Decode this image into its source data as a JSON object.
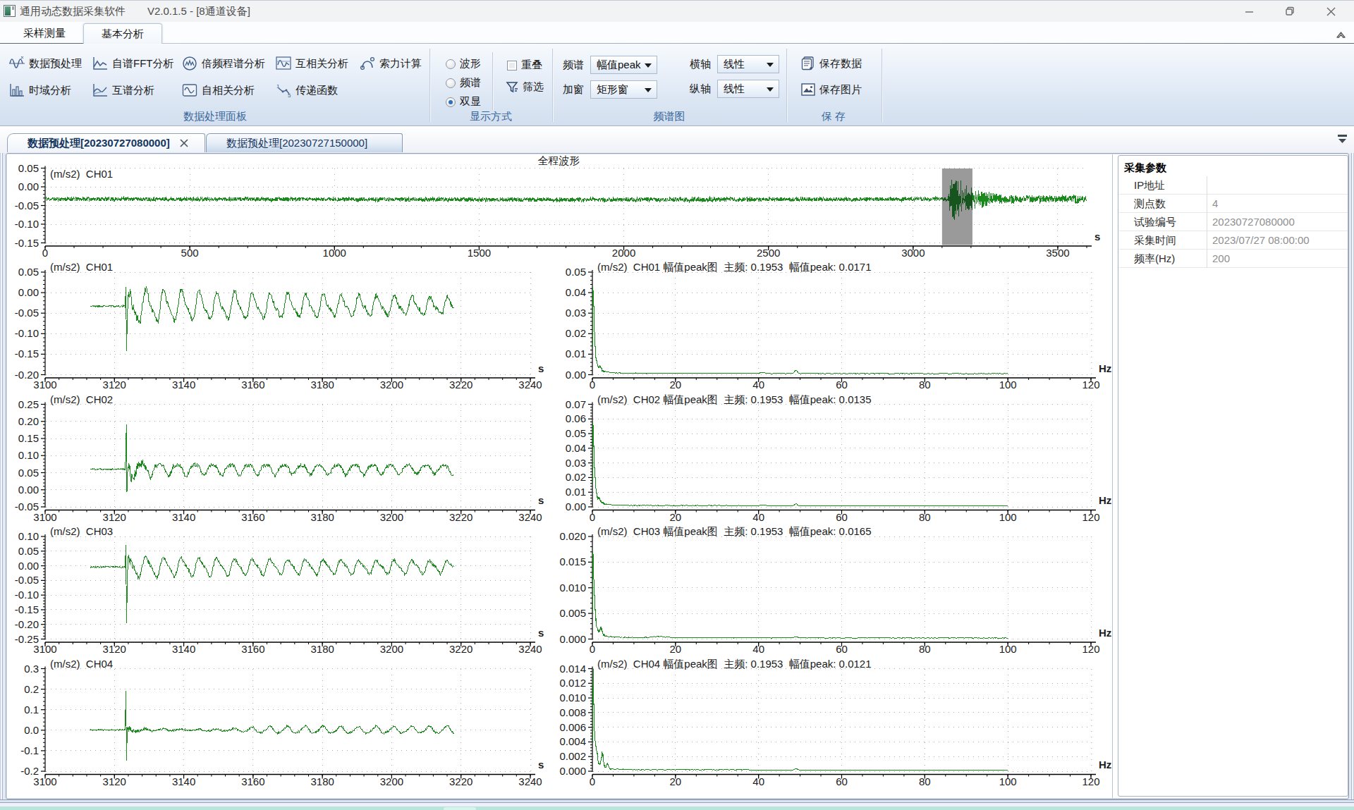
{
  "window": {
    "title": "通用动态数据采集软件",
    "version": "V2.0.1.5 - [8通道设备]"
  },
  "ribbon_tabs": {
    "sampling": "采样测量",
    "analysis": "基本分析"
  },
  "ribbon": {
    "group1": {
      "label": "数据处理面板",
      "buttons": {
        "preprocess": "数据预处理",
        "autospectrum": "自谱FFT分析",
        "octave": "倍频程谱分析",
        "crosscorr": "互相关分析",
        "cableforce": "索力计算",
        "timedomain": "时域分析",
        "crossspectrum": "互谱分析",
        "autocorr": "自相关分析",
        "transferfn": "传递函数"
      }
    },
    "group2": {
      "label": "显示方式",
      "radio_wave": {
        "label": "波形",
        "checked": false
      },
      "radio_spectrum": {
        "label": "频谱",
        "checked": false
      },
      "radio_dual": {
        "label": "双显",
        "checked": true
      },
      "checkbox_overlap": {
        "label": "重叠",
        "checked": false
      },
      "button_filter": {
        "label": "筛选"
      }
    },
    "group3": {
      "label": "频谱图",
      "spectrum_type": {
        "label": "频谱",
        "value": "幅值peak"
      },
      "window_fn": {
        "label": "加窗",
        "value": "矩形窗"
      },
      "x_axis": {
        "label": "横轴",
        "value": "线性"
      },
      "y_axis": {
        "label": "纵轴",
        "value": "线性"
      }
    },
    "group4": {
      "label": "保 存",
      "save_data": "保存数据",
      "save_image": "保存图片"
    }
  },
  "document_tabs": {
    "tab0": "数据预处理[20230727080000]",
    "tab1": "数据预处理[20230727150000]"
  },
  "params_panel": {
    "title": "采集参数",
    "rows": [
      {
        "label": "IP地址",
        "value": ""
      },
      {
        "label": "测点数",
        "value": "4"
      },
      {
        "label": "试验编号",
        "value": "20230727080000"
      },
      {
        "label": "采集时间",
        "value": "2023/07/27 08:00:00"
      },
      {
        "label": "频率(Hz)",
        "value": "200"
      }
    ]
  },
  "colors": {
    "trace_green": "#1b8a1d",
    "trace_green_dark": "#16551d",
    "selection_gray": "#9a9a9a",
    "axis_black": "#000000",
    "grid_gray": "#ababab",
    "label_dark": "#1b1b1b",
    "group_label_blue": "#39689c"
  },
  "chart_data": [
    {
      "id": "overview",
      "type": "line",
      "title": "全程波形",
      "inplot_label": "(m/s2)  CH01",
      "xlabel": "s",
      "xlim": [
        0,
        3600
      ],
      "ylim": [
        -0.15,
        0.05
      ],
      "xticks": [
        0,
        500,
        1000,
        1500,
        2000,
        2500,
        3000,
        3500
      ],
      "xtick_minor_step": 100,
      "yticks": [
        "0.05",
        "0.00",
        "-0.05",
        "-0.10",
        "-0.15"
      ],
      "ytick_values": [
        0.05,
        0.0,
        -0.05,
        -0.1,
        -0.15
      ],
      "selection": {
        "from": 3100,
        "to": 3205
      },
      "gen": {
        "kind": "noise",
        "seed": 11,
        "dt": 1.0,
        "base": -0.0335,
        "drift_amp": 0.0009,
        "noise_amp": 0.0052,
        "mid_bump": {
          "t": 2250,
          "sigma": 140,
          "amp": 0.0017
        },
        "burst": {
          "t0": 3123,
          "amp": 0.05,
          "peak_end": 3152,
          "tau": 75,
          "osc_frac": 0.75,
          "freq": 0.1953
        },
        "post": {
          "floor": 0.0078,
          "amp": 0.008,
          "tau": 180
        },
        "end_bump": {
          "t": 3563,
          "sigma": 13,
          "amp": 0.0045
        }
      }
    },
    {
      "id": "time_ch01",
      "type": "line",
      "inplot_label": "(m/s2)  CH01",
      "xlabel": "s",
      "xlim": [
        3100,
        3240
      ],
      "ylim": [
        -0.2,
        0.05
      ],
      "xticks": [
        3100,
        3120,
        3140,
        3160,
        3180,
        3200,
        3220,
        3240
      ],
      "xtick_minor_step": 4,
      "yticks": [
        "0.05",
        "0.00",
        "-0.05",
        "-0.10",
        "-0.15",
        "-0.20"
      ],
      "ytick_values": [
        0.05,
        0.0,
        -0.05,
        -0.1,
        -0.15,
        -0.2
      ],
      "gen": {
        "kind": "transient",
        "seed": 21,
        "t0": 3113,
        "t1": 3218,
        "dt": 0.15,
        "base": -0.033,
        "pre_noise": 0.0022,
        "spike": [
          [
            3123.1,
            -0.031
          ],
          [
            3123.3,
            0.014
          ],
          [
            3123.5,
            -0.142
          ],
          [
            3123.75,
            -0.05
          ],
          [
            3123.9,
            -0.024
          ]
        ],
        "mess": {
          "amp": 0.016,
          "tau": 3.5
        },
        "osc": {
          "freq": 0.1953,
          "a_min": 0.012,
          "a0": 0.026,
          "tau": 70,
          "phase": 1.2,
          "h2": 0.33,
          "phase2": 2.0
        },
        "noise": 0.0058
      }
    },
    {
      "id": "time_ch02",
      "type": "line",
      "inplot_label": "(m/s2)  CH02",
      "xlabel": "s",
      "xlim": [
        3100,
        3240
      ],
      "ylim": [
        -0.05,
        0.25
      ],
      "xticks": [
        3100,
        3120,
        3140,
        3160,
        3180,
        3200,
        3220,
        3240
      ],
      "xtick_minor_step": 4,
      "yticks": [
        "0.25",
        "0.20",
        "0.15",
        "0.10",
        "0.05",
        "0.00",
        "-0.05"
      ],
      "ytick_values": [
        0.25,
        0.2,
        0.15,
        0.1,
        0.05,
        0.0,
        -0.05
      ],
      "gen": {
        "kind": "transient",
        "seed": 22,
        "t0": 3113,
        "t1": 3218,
        "dt": 0.15,
        "base": 0.0605,
        "pre_noise": 0.002,
        "spike": [
          [
            3123.1,
            0.062
          ],
          [
            3123.3,
            0.1
          ],
          [
            3123.45,
            0.191
          ],
          [
            3123.6,
            -0.006
          ],
          [
            3123.8,
            0.052
          ]
        ],
        "mess": {
          "amp": 0.02,
          "tau": 5
        },
        "osc": {
          "freq": 0.1953,
          "a_min": 0.011,
          "a0": 0.007,
          "tau": 60,
          "phase": 2.8,
          "h2": 0.25,
          "phase2": 1.0
        },
        "noise": 0.005
      }
    },
    {
      "id": "time_ch03",
      "type": "line",
      "inplot_label": "(m/s2)  CH03",
      "xlabel": "s",
      "xlim": [
        3100,
        3240
      ],
      "ylim": [
        -0.25,
        0.1
      ],
      "xticks": [
        3100,
        3120,
        3140,
        3160,
        3180,
        3200,
        3220,
        3240
      ],
      "xtick_minor_step": 4,
      "yticks": [
        "0.10",
        "0.05",
        "0.00",
        "-0.05",
        "-0.10",
        "-0.15",
        "-0.20",
        "-0.25"
      ],
      "ytick_values": [
        0.1,
        0.05,
        0.0,
        -0.05,
        -0.1,
        -0.15,
        -0.2,
        -0.25
      ],
      "gen": {
        "kind": "transient",
        "seed": 23,
        "t0": 3113,
        "t1": 3218,
        "dt": 0.15,
        "base": -0.004,
        "pre_noise": 0.0025,
        "spike": [
          [
            3123.1,
            -0.003
          ],
          [
            3123.3,
            0.072
          ],
          [
            3123.5,
            -0.196
          ],
          [
            3123.75,
            -0.035
          ]
        ],
        "mess": {
          "amp": 0.014,
          "tau": 3
        },
        "osc": {
          "freq": 0.1953,
          "a_min": 0.015,
          "a0": 0.017,
          "tau": 70,
          "phase": 1.0,
          "h2": 0.3,
          "phase2": 2.2
        },
        "noise": 0.005
      }
    },
    {
      "id": "time_ch04",
      "type": "line",
      "inplot_label": "(m/s2)  CH04",
      "xlabel": "s",
      "xlim": [
        3100,
        3240
      ],
      "ylim": [
        -0.2,
        0.3
      ],
      "xticks": [
        3100,
        3120,
        3140,
        3160,
        3180,
        3200,
        3220,
        3240
      ],
      "xtick_minor_step": 4,
      "yticks": [
        "0.3",
        "0.2",
        "0.1",
        "0.0",
        "-0.1",
        "-0.2"
      ],
      "ytick_values": [
        0.3,
        0.2,
        0.1,
        0.0,
        -0.1,
        -0.2
      ],
      "gen": {
        "kind": "transient",
        "seed": 24,
        "t0": 3113,
        "t1": 3218,
        "dt": 0.15,
        "base": 0.001,
        "pre_noise": 0.0025,
        "spike": [
          [
            3123.1,
            0.002
          ],
          [
            3123.3,
            0.19
          ],
          [
            3123.5,
            -0.148
          ],
          [
            3123.7,
            0.012
          ]
        ],
        "mess": {
          "amp": 0.012,
          "tau": 4
        },
        "osc": {
          "freq": 0.1953,
          "a_min": 0.0045,
          "a0": 0.012,
          "ramp_t0": 3150,
          "ramp_w": 16,
          "phase": 1.5,
          "h2": 0.2,
          "phase2": 0.6
        },
        "noise": 0.0042
      }
    },
    {
      "id": "spec_ch01",
      "type": "line",
      "inplot_label": "(m/s2)  CH01 幅值peak图  主频: 0.1953  幅值peak: 0.0171",
      "main_freq": 0.1953,
      "peak_value": 0.0171,
      "xlabel": "Hz",
      "xlim": [
        0,
        120
      ],
      "data_xmax": 100,
      "ylim": [
        0,
        0.05
      ],
      "xticks": [
        0,
        20,
        40,
        60,
        80,
        100,
        120
      ],
      "xtick_minor_step": 5,
      "yticks": [
        "0.05",
        "0.04",
        "0.03",
        "0.02",
        "0.01",
        "0.00"
      ],
      "ytick_values": [
        0.05,
        0.04,
        0.03,
        0.02,
        0.01,
        0.0
      ],
      "gen": {
        "kind": "spectrum",
        "seed": 31,
        "peak": 0.041,
        "subpeaks": [
          {
            "f": 1.9,
            "h": 0.0015,
            "w": 0.35
          },
          {
            "f": 41,
            "h": 0.00055,
            "w": 0.8
          },
          {
            "f": 49,
            "h": 0.0017,
            "w": 0.45
          }
        ]
      }
    },
    {
      "id": "spec_ch02",
      "type": "line",
      "inplot_label": "(m/s2)  CH02 幅值peak图  主频: 0.1953  幅值peak: 0.0135",
      "main_freq": 0.1953,
      "peak_value": 0.0135,
      "xlabel": "Hz",
      "xlim": [
        0,
        120
      ],
      "data_xmax": 100,
      "ylim": [
        0,
        0.07
      ],
      "xticks": [
        0,
        20,
        40,
        60,
        80,
        100,
        120
      ],
      "xtick_minor_step": 5,
      "yticks": [
        "0.07",
        "0.06",
        "0.05",
        "0.04",
        "0.03",
        "0.02",
        "0.01",
        "0.00"
      ],
      "ytick_values": [
        0.07,
        0.06,
        0.05,
        0.04,
        0.03,
        0.02,
        0.01,
        0.0
      ],
      "gen": {
        "kind": "spectrum",
        "seed": 32,
        "peak": 0.056,
        "subpeaks": [
          {
            "f": 1.7,
            "h": 0.002,
            "w": 0.3
          },
          {
            "f": 41,
            "h": 0.0006,
            "w": 0.8
          },
          {
            "f": 49,
            "h": 0.0013,
            "w": 0.45
          }
        ]
      }
    },
    {
      "id": "spec_ch03",
      "type": "line",
      "inplot_label": "(m/s2)  CH03 幅值peak图  主频: 0.1953  幅值peak: 0.0165",
      "main_freq": 0.1953,
      "peak_value": 0.0165,
      "xlabel": "Hz",
      "xlim": [
        0,
        120
      ],
      "data_xmax": 100,
      "ylim": [
        0,
        0.02
      ],
      "xticks": [
        0,
        20,
        40,
        60,
        80,
        100,
        120
      ],
      "xtick_minor_step": 5,
      "yticks": [
        "0.020",
        "0.015",
        "0.010",
        "0.005",
        "0.000"
      ],
      "ytick_values": [
        0.02,
        0.015,
        0.01,
        0.005,
        0.0
      ],
      "gen": {
        "kind": "spectrum",
        "seed": 33,
        "peak": 0.0165,
        "subpeaks": [
          {
            "f": 2.1,
            "h": 0.0012,
            "w": 0.4
          },
          {
            "f": 16,
            "h": 0.0002,
            "w": 2
          },
          {
            "f": 49,
            "h": 0.00028,
            "w": 0.5
          }
        ]
      }
    },
    {
      "id": "spec_ch04",
      "type": "line",
      "inplot_label": "(m/s2)  CH04 幅值peak图  主频: 0.1953  幅值peak: 0.0121",
      "main_freq": 0.1953,
      "peak_value": 0.0121,
      "xlabel": "Hz",
      "xlim": [
        0,
        120
      ],
      "data_xmax": 100,
      "ylim": [
        0,
        0.014
      ],
      "xticks": [
        0,
        20,
        40,
        60,
        80,
        100,
        120
      ],
      "xtick_minor_step": 5,
      "yticks": [
        "0.014",
        "0.012",
        "0.010",
        "0.008",
        "0.006",
        "0.004",
        "0.002",
        "0.000"
      ],
      "ytick_values": [
        0.014,
        0.012,
        0.01,
        0.008,
        0.006,
        0.004,
        0.002,
        0.0
      ],
      "gen": {
        "kind": "spectrum",
        "seed": 34,
        "peak": 0.0121,
        "subpeaks": [
          {
            "f": 1.1,
            "h": 0.0012,
            "w": 0.25
          },
          {
            "f": 2.4,
            "h": 0.0018,
            "w": 0.35
          },
          {
            "f": 3.6,
            "h": 0.0007,
            "w": 0.3
          },
          {
            "f": 49,
            "h": 0.00018,
            "w": 0.5
          }
        ]
      }
    }
  ]
}
